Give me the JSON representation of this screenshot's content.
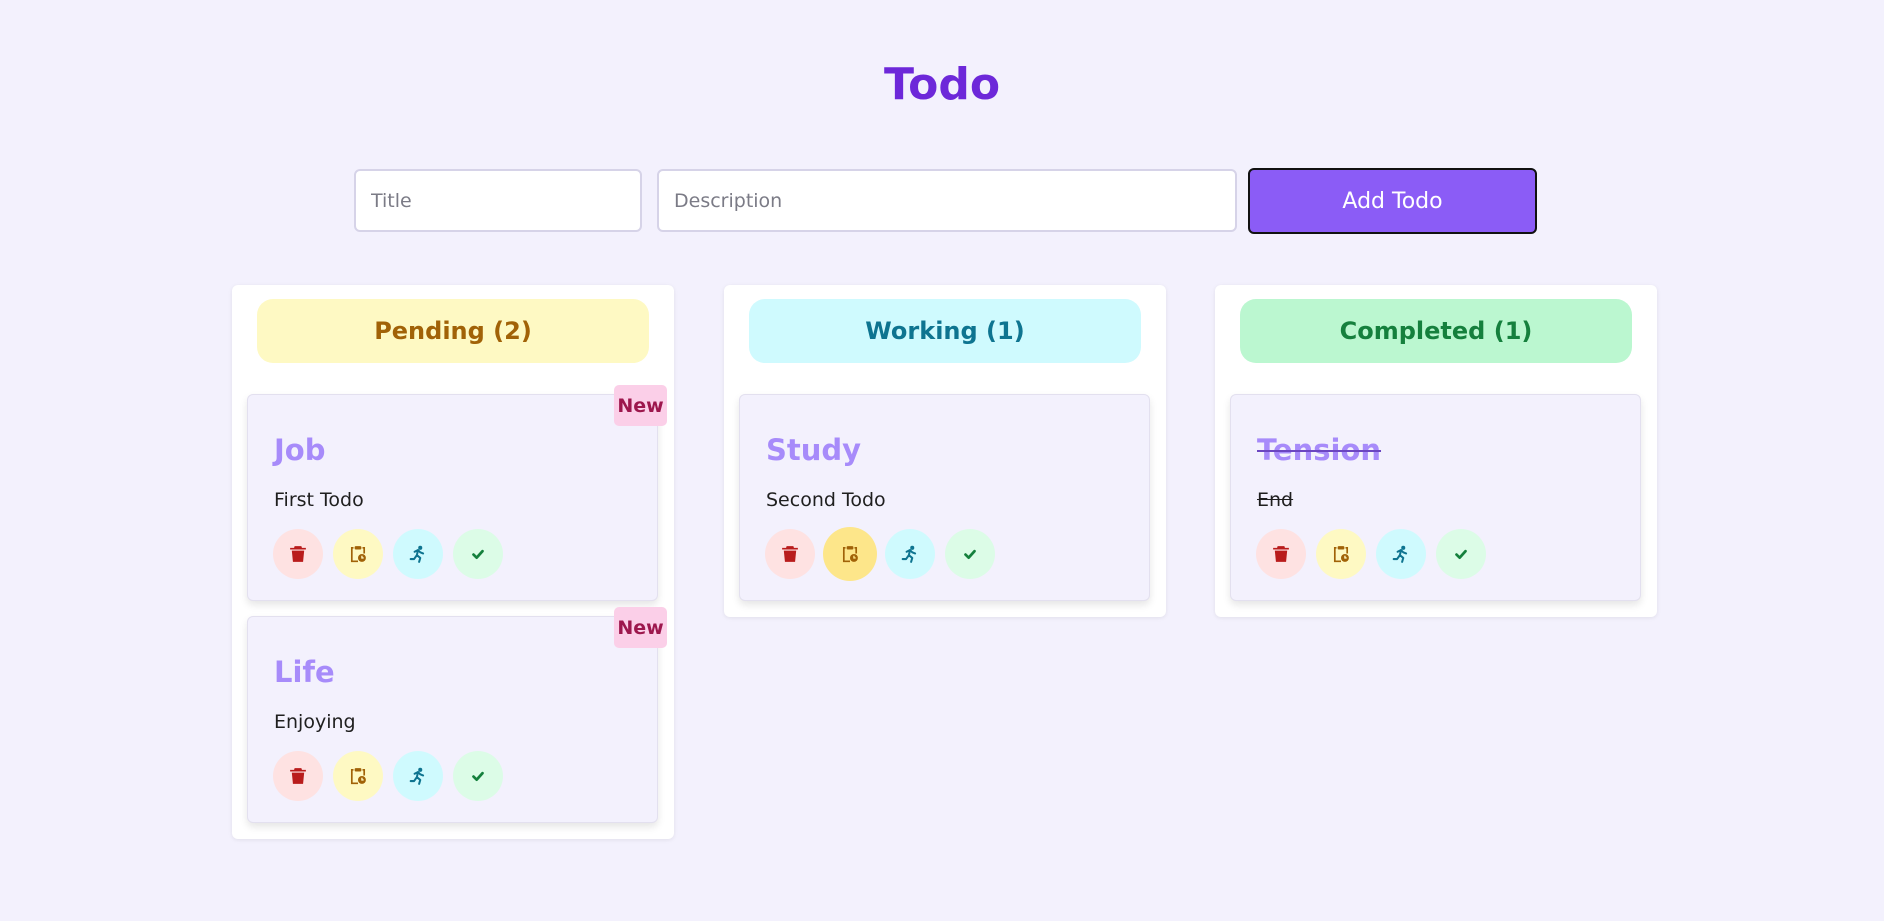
{
  "app": {
    "title": "Todo"
  },
  "form": {
    "title_placeholder": "Title",
    "title_value": "",
    "description_placeholder": "Description",
    "description_value": "",
    "add_label": "Add Todo"
  },
  "colors": {
    "title": "#6d28d9",
    "add_button": "#8b5cf6",
    "pending_bg": "#fef9c3",
    "pending_text": "#a16207",
    "working_bg": "#cffafe",
    "working_text": "#0e7490",
    "completed_bg": "#bbf7d0",
    "completed_text": "#15803d",
    "new_badge_bg": "#fbcfe8",
    "new_badge_text": "#9d174d"
  },
  "columns": [
    {
      "header": "Pending (2)",
      "cards": [
        {
          "title": "Job",
          "description": "First Todo",
          "badge": "New"
        },
        {
          "title": "Life",
          "description": "Enjoying",
          "badge": "New"
        }
      ]
    },
    {
      "header": "Working (1)",
      "cards": [
        {
          "title": "Study",
          "description": "Second Todo"
        }
      ]
    },
    {
      "header": "Completed (1)",
      "cards": [
        {
          "title": "Tension",
          "description": "End"
        }
      ]
    }
  ],
  "action_icons": [
    "trash-icon",
    "clipboard-clock-icon",
    "running-person-icon",
    "check-icon"
  ]
}
